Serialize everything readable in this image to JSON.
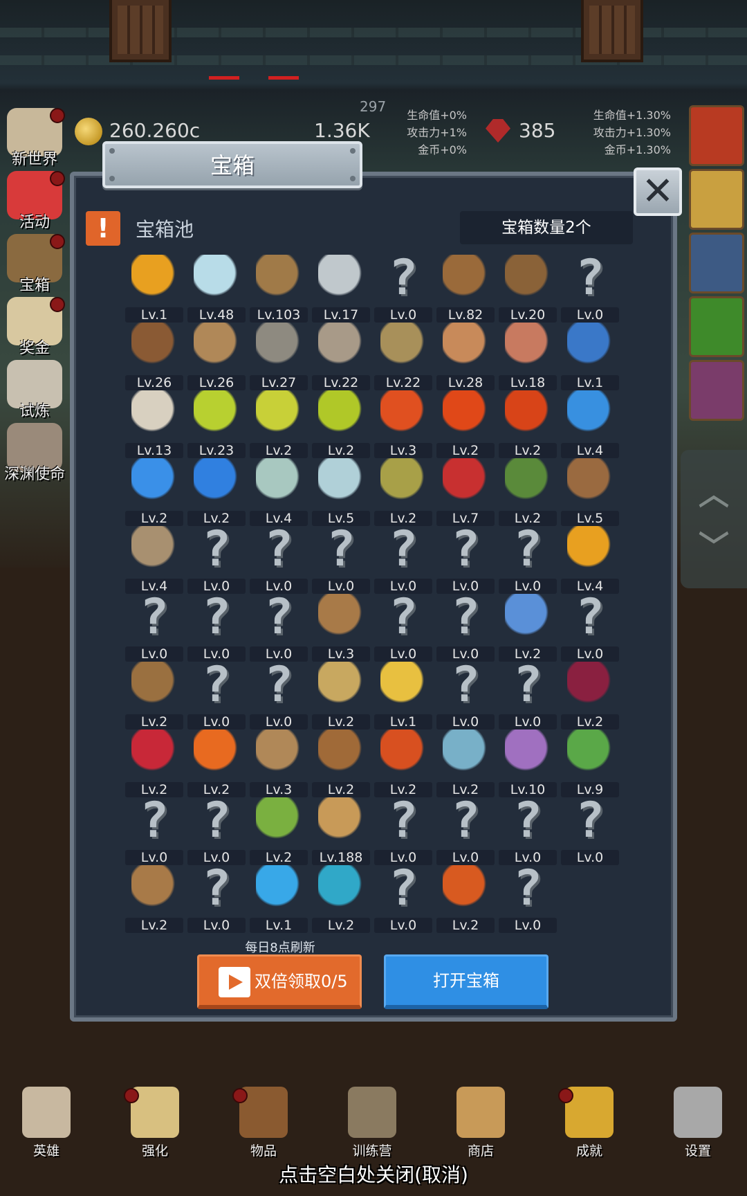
{
  "hud": {
    "gold": "260.260c",
    "bread": "1.36K",
    "counter": "297",
    "left_bonus": [
      "生命值+0%",
      "攻击力+1%",
      "金币+0%"
    ],
    "gems": "385",
    "right_bonus": [
      "生命值+1.30%",
      "攻击力+1.30%",
      "金币+1.30%"
    ]
  },
  "side_menu": [
    {
      "label": "新世界",
      "icon": "map-scroll-icon",
      "dot": true
    },
    {
      "label": "活动",
      "icon": "heart-icon",
      "dot": true
    },
    {
      "label": "宝箱",
      "icon": "treasure-chest-icon",
      "dot": true
    },
    {
      "label": "奖金",
      "icon": "envelope-icon",
      "dot": true
    },
    {
      "label": "试炼",
      "icon": "feather-icon",
      "dot": false
    },
    {
      "label": "深渊使命",
      "icon": "crystal-orb-icon",
      "dot": false
    }
  ],
  "right_tiles": [
    {
      "icon": "apple-icon",
      "color": "#b83a22"
    },
    {
      "icon": "candle-icon",
      "color": "#c9a040"
    },
    {
      "icon": "shield-face-icon",
      "color": "#3d5a84"
    },
    {
      "icon": "slime-icon",
      "color": "#3e8a2a"
    },
    {
      "icon": "goblin-icon",
      "color": "#7a3c6a"
    }
  ],
  "modal": {
    "title": "宝箱",
    "pool_label": "宝箱池",
    "count_text": "宝箱数量2个",
    "refresh_note": "每日8点刷新",
    "double_button": "双倍领取0/5",
    "open_button": "打开宝箱"
  },
  "items": [
    {
      "icon": "crown-icon",
      "level": "Lv.1",
      "color": "#e8a020"
    },
    {
      "icon": "diamond-icon",
      "level": "Lv.48",
      "color": "#b8dce8"
    },
    {
      "icon": "sword-icon",
      "level": "Lv.103",
      "color": "#a07a48"
    },
    {
      "icon": "steel-sword-icon",
      "level": "Lv.17",
      "color": "#c0c8cc"
    },
    {
      "icon": "unknown-icon",
      "level": "Lv.0",
      "color": ""
    },
    {
      "icon": "leather-armor-icon",
      "level": "Lv.82",
      "color": "#9a6a3a"
    },
    {
      "icon": "backpack-icon",
      "level": "Lv.20",
      "color": "#8a6238"
    },
    {
      "icon": "unknown-icon",
      "level": "Lv.0",
      "color": ""
    },
    {
      "icon": "leather-helmet-icon",
      "level": "Lv.26",
      "color": "#8a5a34"
    },
    {
      "icon": "dagger-icon",
      "level": "Lv.26",
      "color": "#b08858"
    },
    {
      "icon": "knight-helmet-icon",
      "level": "Lv.27",
      "color": "#8e8a80"
    },
    {
      "icon": "hammer-icon",
      "level": "Lv.22",
      "color": "#a89a88"
    },
    {
      "icon": "great-helm-icon",
      "level": "Lv.22",
      "color": "#a8905a"
    },
    {
      "icon": "ham-icon",
      "level": "Lv.28",
      "color": "#c88a5a"
    },
    {
      "icon": "steak-icon",
      "level": "Lv.18",
      "color": "#c87a60"
    },
    {
      "icon": "pouch-icon",
      "level": "Lv.1",
      "color": "#3a78c8"
    },
    {
      "icon": "rice-bowl-icon",
      "level": "Lv.13",
      "color": "#d8d0c0"
    },
    {
      "icon": "yellow-potion-icon",
      "level": "Lv.23",
      "color": "#b8d030"
    },
    {
      "icon": "yellow-potion-icon",
      "level": "Lv.2",
      "color": "#c8d038"
    },
    {
      "icon": "yellow-potion-icon",
      "level": "Lv.2",
      "color": "#b0c828"
    },
    {
      "icon": "red-potion-icon",
      "level": "Lv.3",
      "color": "#e05020"
    },
    {
      "icon": "red-potion-icon",
      "level": "Lv.2",
      "color": "#e04818"
    },
    {
      "icon": "red-potion-icon",
      "level": "Lv.2",
      "color": "#d84418"
    },
    {
      "icon": "blue-potion-icon",
      "level": "Lv.4",
      "color": "#3890e0"
    },
    {
      "icon": "blue-potion-icon",
      "level": "Lv.2",
      "color": "#3a90e8"
    },
    {
      "icon": "blue-potion-icon",
      "level": "Lv.2",
      "color": "#3080e0"
    },
    {
      "icon": "glass-vial-icon",
      "level": "Lv.4",
      "color": "#a8c8c0"
    },
    {
      "icon": "glass-vial-icon",
      "level": "Lv.5",
      "color": "#b0d0d8"
    },
    {
      "icon": "green-bottle-icon",
      "level": "Lv.2",
      "color": "#a8a048"
    },
    {
      "icon": "red-bottle-icon",
      "level": "Lv.7",
      "color": "#c83030"
    },
    {
      "icon": "winged-boot-icon",
      "level": "Lv.2",
      "color": "#5a8a3a"
    },
    {
      "icon": "boot-icon",
      "level": "Lv.5",
      "color": "#9a6a40"
    },
    {
      "icon": "boot-icon",
      "level": "Lv.4",
      "color": "#a89070"
    },
    {
      "icon": "unknown-icon",
      "level": "Lv.0",
      "color": ""
    },
    {
      "icon": "unknown-icon",
      "level": "Lv.0",
      "color": ""
    },
    {
      "icon": "unknown-icon",
      "level": "Lv.0",
      "color": ""
    },
    {
      "icon": "unknown-icon",
      "level": "Lv.0",
      "color": ""
    },
    {
      "icon": "unknown-icon",
      "level": "Lv.0",
      "color": ""
    },
    {
      "icon": "unknown-icon",
      "level": "Lv.0",
      "color": ""
    },
    {
      "icon": "torch-icon",
      "level": "Lv.4",
      "color": "#e8a020"
    },
    {
      "icon": "unknown-icon",
      "level": "Lv.0",
      "color": ""
    },
    {
      "icon": "unknown-icon",
      "level": "Lv.0",
      "color": ""
    },
    {
      "icon": "unknown-icon",
      "level": "Lv.0",
      "color": ""
    },
    {
      "icon": "wooden-staff-icon",
      "level": "Lv.3",
      "color": "#a87a48"
    },
    {
      "icon": "unknown-icon",
      "level": "Lv.0",
      "color": ""
    },
    {
      "icon": "unknown-icon",
      "level": "Lv.0",
      "color": ""
    },
    {
      "icon": "blue-wand-icon",
      "level": "Lv.2",
      "color": "#5a90d8"
    },
    {
      "icon": "unknown-icon",
      "level": "Lv.0",
      "color": ""
    },
    {
      "icon": "satchel-icon",
      "level": "Lv.2",
      "color": "#9a7040"
    },
    {
      "icon": "unknown-icon",
      "level": "Lv.0",
      "color": ""
    },
    {
      "icon": "unknown-icon",
      "level": "Lv.0",
      "color": ""
    },
    {
      "icon": "horn-icon",
      "level": "Lv.2",
      "color": "#c8a860"
    },
    {
      "icon": "cheese-icon",
      "level": "Lv.1",
      "color": "#e8c040"
    },
    {
      "icon": "unknown-icon",
      "level": "Lv.0",
      "color": ""
    },
    {
      "icon": "unknown-icon",
      "level": "Lv.0",
      "color": ""
    },
    {
      "icon": "dark-crystal-icon",
      "level": "Lv.2",
      "color": "#8a2040"
    },
    {
      "icon": "red-gem-button-icon",
      "level": "Lv.2",
      "color": "#c82838"
    },
    {
      "icon": "fire-rune-icon",
      "level": "Lv.2",
      "color": "#e86a20"
    },
    {
      "icon": "bow-icon",
      "level": "Lv.3",
      "color": "#b08858"
    },
    {
      "icon": "crossbow-icon",
      "level": "Lv.2",
      "color": "#a06a38"
    },
    {
      "icon": "flame-shield-icon",
      "level": "Lv.2",
      "color": "#d85020"
    },
    {
      "icon": "frost-shield-icon",
      "level": "Lv.2",
      "color": "#78b0c8"
    },
    {
      "icon": "tentacle-charm-icon",
      "level": "Lv.10",
      "color": "#a070c0"
    },
    {
      "icon": "emerald-amulet-icon",
      "level": "Lv.9",
      "color": "#5aa848"
    },
    {
      "icon": "unknown-icon",
      "level": "Lv.0",
      "color": ""
    },
    {
      "icon": "unknown-icon",
      "level": "Lv.0",
      "color": ""
    },
    {
      "icon": "green-wand-icon",
      "level": "Lv.2",
      "color": "#7ab040"
    },
    {
      "icon": "beer-mug-icon",
      "level": "Lv.188",
      "color": "#c89a58"
    },
    {
      "icon": "unknown-icon",
      "level": "Lv.0",
      "color": ""
    },
    {
      "icon": "unknown-icon",
      "level": "Lv.0",
      "color": ""
    },
    {
      "icon": "unknown-icon",
      "level": "Lv.0",
      "color": ""
    },
    {
      "icon": "unknown-icon",
      "level": "Lv.0",
      "color": ""
    },
    {
      "icon": "rope-whip-icon",
      "level": "Lv.2",
      "color": "#a87a48"
    },
    {
      "icon": "unknown-icon",
      "level": "Lv.0",
      "color": ""
    },
    {
      "icon": "crystal-ball-icon",
      "level": "Lv.1",
      "color": "#38a8e8"
    },
    {
      "icon": "rune-orb-icon",
      "level": "Lv.2",
      "color": "#30a8c8"
    },
    {
      "icon": "unknown-icon",
      "level": "Lv.0",
      "color": ""
    },
    {
      "icon": "fire-arrow-icon",
      "level": "Lv.2",
      "color": "#d85a20"
    },
    {
      "icon": "unknown-icon",
      "level": "Lv.0",
      "color": ""
    }
  ],
  "bottom_nav": [
    {
      "label": "英雄",
      "icon": "skull-icon",
      "dot": false,
      "color": "#c8b8a0"
    },
    {
      "label": "强化",
      "icon": "candle-icon",
      "dot": true,
      "color": "#d8c080"
    },
    {
      "label": "物品",
      "icon": "book-icon",
      "dot": true,
      "color": "#8a5a30"
    },
    {
      "label": "训练营",
      "icon": "lantern-icon",
      "dot": false,
      "color": "#8a7a60"
    },
    {
      "label": "商店",
      "icon": "beer-mug-icon",
      "dot": false,
      "color": "#c89a58"
    },
    {
      "label": "成就",
      "icon": "key-icon",
      "dot": true,
      "color": "#d8a830"
    },
    {
      "label": "设置",
      "icon": "gear-icon",
      "dot": false,
      "color": "#a8a8a8"
    }
  ],
  "close_hint": "点击空白处关闭(取消)"
}
